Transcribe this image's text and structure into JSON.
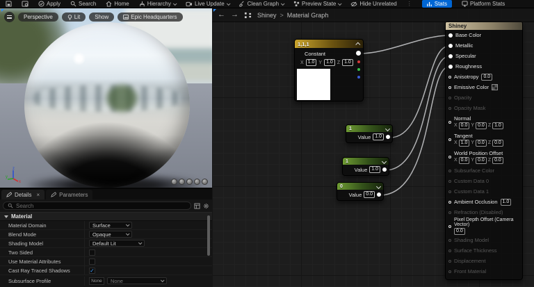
{
  "toolbar": {
    "items": [
      {
        "label": "Apply"
      },
      {
        "label": "Search"
      },
      {
        "label": "Home"
      },
      {
        "label": "Hierarchy",
        "dropdown": true
      },
      {
        "label": "Live Update",
        "dropdown": true
      },
      {
        "label": "Clean Graph",
        "dropdown": true
      },
      {
        "label": "Preview State",
        "dropdown": true
      },
      {
        "label": "Hide Unrelated"
      },
      {
        "label": "Stats",
        "active": true,
        "accent_color": "#0066d4"
      },
      {
        "label": "Platform Stats"
      }
    ]
  },
  "viewport": {
    "buttons": [
      {
        "label": "Perspective"
      },
      {
        "label": "Lit"
      },
      {
        "label": "Show"
      },
      {
        "label": "Epic Headquarters"
      }
    ],
    "gizmo": {
      "x": "x",
      "y": "y",
      "z": "z"
    }
  },
  "details": {
    "tabs": [
      {
        "label": "Details",
        "closable": true
      },
      {
        "label": "Parameters"
      }
    ],
    "search_placeholder": "Search",
    "section": "Material",
    "rows": [
      {
        "label": "Material Domain",
        "control": "dropdown",
        "value": "Surface"
      },
      {
        "label": "Blend Mode",
        "control": "dropdown",
        "value": "Opaque"
      },
      {
        "label": "Shading Model",
        "control": "dropdown",
        "value": "Default Lit"
      },
      {
        "label": "Two Sided",
        "control": "checkbox",
        "checked": false
      },
      {
        "label": "Use Material Attributes",
        "control": "checkbox",
        "checked": false
      },
      {
        "label": "Cast Ray Traced Shadows",
        "control": "checkbox",
        "checked": true
      },
      {
        "label": "Subsurface Profile",
        "control": "asset",
        "thumb": "None",
        "value": "None"
      }
    ]
  },
  "graph": {
    "breadcrumb": {
      "root": "Shiney",
      "separator": ">",
      "current": "Material Graph"
    },
    "constant_node": {
      "header": "1,1,1",
      "title": "Constant",
      "axis_labels": [
        "X",
        "Y",
        "Z"
      ],
      "values": [
        "1.0",
        "1.0",
        "1.0"
      ]
    },
    "scalar_nodes": [
      {
        "header": "1",
        "label": "Value",
        "value": "1.0"
      },
      {
        "header": "1",
        "label": "Value",
        "value": "1.0"
      },
      {
        "header": "0",
        "label": "Value",
        "value": "0.0"
      }
    ],
    "shiney": {
      "title": "Shiney",
      "axis_labels": [
        "X",
        "Y",
        "Z"
      ],
      "pins": [
        {
          "label": "Base Color",
          "state": "connected"
        },
        {
          "label": "Metallic",
          "state": "connected"
        },
        {
          "label": "Specular",
          "state": "connected"
        },
        {
          "label": "Roughness",
          "state": "connected"
        },
        {
          "label": "Anisotropy",
          "state": "default",
          "value": "0.0"
        },
        {
          "label": "Emissive Color",
          "state": "default",
          "swatch": true
        },
        {
          "label": "Opacity",
          "state": "disabled"
        },
        {
          "label": "Opacity Mask",
          "state": "disabled"
        },
        {
          "label": "Normal",
          "state": "default",
          "xyz": [
            "0.0",
            "0.0",
            "1.0"
          ]
        },
        {
          "label": "Tangent",
          "state": "default",
          "xyz": [
            "1.0",
            "0.0",
            "0.0"
          ]
        },
        {
          "label": "World Position Offset",
          "state": "default",
          "xyz": [
            "0.0",
            "0.0",
            "0.0"
          ]
        },
        {
          "label": "Subsurface Color",
          "state": "disabled"
        },
        {
          "label": "Custom Data 0",
          "state": "disabled"
        },
        {
          "label": "Custom Data 1",
          "state": "disabled"
        },
        {
          "label": "Ambient Occlusion",
          "state": "default",
          "value": "1.0"
        },
        {
          "label": "Refraction (Disabled)",
          "state": "disabled"
        },
        {
          "label": "Pixel Depth Offset (Camera Vector)",
          "state": "default",
          "value": "0.0",
          "wrap": true
        },
        {
          "label": "Shading Model",
          "state": "disabled"
        },
        {
          "label": "Surface Thickness",
          "state": "disabled"
        },
        {
          "label": "Displacement",
          "state": "disabled"
        },
        {
          "label": "Front Material",
          "state": "disabled"
        }
      ]
    },
    "wire_color": "#cdced0"
  }
}
